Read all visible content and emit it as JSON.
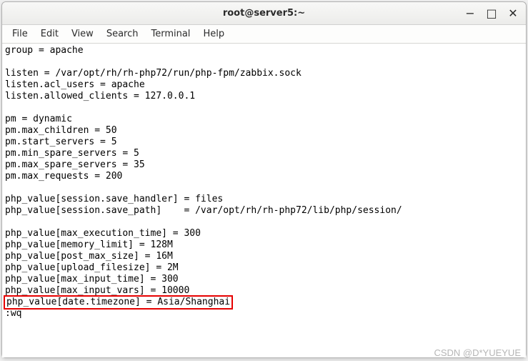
{
  "window": {
    "title": "root@server5:~"
  },
  "menu": {
    "items": [
      "File",
      "Edit",
      "View",
      "Search",
      "Terminal",
      "Help"
    ]
  },
  "terminal": {
    "lines": [
      "group = apache",
      "",
      "listen = /var/opt/rh/rh-php72/run/php-fpm/zabbix.sock",
      "listen.acl_users = apache",
      "listen.allowed_clients = 127.0.0.1",
      "",
      "pm = dynamic",
      "pm.max_children = 50",
      "pm.start_servers = 5",
      "pm.min_spare_servers = 5",
      "pm.max_spare_servers = 35",
      "pm.max_requests = 200",
      "",
      "php_value[session.save_handler] = files",
      "php_value[session.save_path]    = /var/opt/rh/rh-php72/lib/php/session/",
      "",
      "php_value[max_execution_time] = 300",
      "php_value[memory_limit] = 128M",
      "php_value[post_max_size] = 16M",
      "php_value[upload_filesize] = 2M",
      "php_value[max_input_time] = 300",
      "php_value[max_input_vars] = 10000",
      "php_value[date.timezone] = Asia/Shanghai",
      ":wq"
    ],
    "highlighted_line": "php_value[date.timezone] = Asia/Shanghai"
  },
  "watermark": "CSDN @D*YUEYUE",
  "icons": {
    "minimize": "−",
    "maximize": "□",
    "close": "✕"
  }
}
